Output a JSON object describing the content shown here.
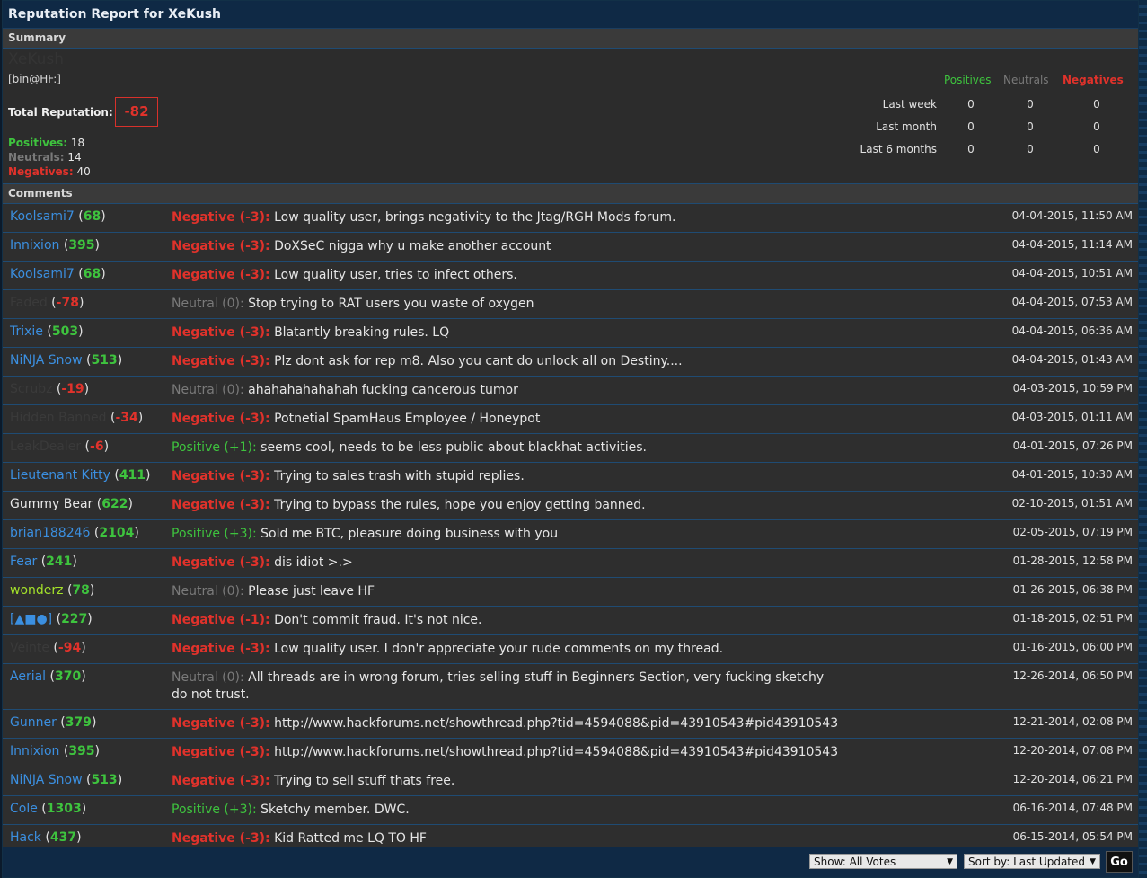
{
  "title": "Reputation Report for XeKush",
  "summary": {
    "heading": "Summary",
    "ghost_name": "XeKush",
    "usertitle": "[bin@HF:]",
    "total_label": "Total Reputation:",
    "total_value": "-82",
    "positives_label": "Positives:",
    "positives_value": "18",
    "neutrals_label": "Neutrals:",
    "neutrals_value": "14",
    "negatives_label": "Negatives:",
    "negatives_value": "40",
    "table_headers": {
      "positives": "Positives",
      "neutrals": "Neutrals",
      "negatives": "Negatives"
    },
    "periods": [
      {
        "label": "Last week",
        "pos": "0",
        "neu": "0",
        "neg": "0"
      },
      {
        "label": "Last month",
        "pos": "0",
        "neu": "0",
        "neg": "0"
      },
      {
        "label": "Last 6 months",
        "pos": "0",
        "neu": "0",
        "neg": "0"
      }
    ]
  },
  "comments_heading": "Comments",
  "comments": [
    {
      "user": "Koolsami7",
      "user_style": "blue",
      "rep": "68",
      "rep_style": "g",
      "type": "neg",
      "tag": "Negative (-3):",
      "text": "Low quality user, brings negativity to the Jtag/RGH Mods forum.",
      "date": "04-04-2015, 11:50 AM"
    },
    {
      "user": "Innixion",
      "user_style": "blue",
      "rep": "395",
      "rep_style": "g",
      "type": "neg",
      "tag": "Negative (-3):",
      "text": "DoXSeC nigga why u make another account",
      "date": "04-04-2015, 11:14 AM"
    },
    {
      "user": "Koolsami7",
      "user_style": "blue",
      "rep": "68",
      "rep_style": "g",
      "type": "neg",
      "tag": "Negative (-3):",
      "text": "Low quality user, tries to infect others.",
      "date": "04-04-2015, 10:51 AM"
    },
    {
      "user": "Faded",
      "user_style": "ghost",
      "rep": "-78",
      "rep_style": "r",
      "type": "neu",
      "tag": "Neutral (0):",
      "text": "Stop trying to RAT users you waste of oxygen",
      "date": "04-04-2015, 07:53 AM"
    },
    {
      "user": "Trixie",
      "user_style": "blue",
      "rep": "503",
      "rep_style": "g",
      "type": "neg",
      "tag": "Negative (-3):",
      "text": "Blatantly breaking rules. LQ",
      "date": "04-04-2015, 06:36 AM"
    },
    {
      "user": "NiNJA Snow",
      "user_style": "blue",
      "rep": "513",
      "rep_style": "g",
      "type": "neg",
      "tag": "Negative (-3):",
      "text": "Plz dont ask for rep m8. Also you cant do unlock all on Destiny....",
      "date": "04-04-2015, 01:43 AM"
    },
    {
      "user": "Scrubz",
      "user_style": "ghost",
      "rep": "-19",
      "rep_style": "r",
      "type": "neu",
      "tag": "Neutral (0):",
      "text": "ahahahahahahah fucking cancerous tumor",
      "date": "04-03-2015, 10:59 PM"
    },
    {
      "user": "Hidden Banned",
      "user_style": "ghost",
      "rep": "-34",
      "rep_style": "r",
      "type": "neg",
      "tag": "Negative (-3):",
      "text": "Potnetial SpamHaus Employee / Honeypot",
      "date": "04-03-2015, 01:11 AM"
    },
    {
      "user": "LeakDealer",
      "user_style": "ghost",
      "rep": "-6",
      "rep_style": "r",
      "type": "pos",
      "tag": "Positive (+1):",
      "text": "seems cool, needs to be less public about blackhat activities.",
      "date": "04-01-2015, 07:26 PM"
    },
    {
      "user": "Lieutenant Kitty",
      "user_style": "blue",
      "rep": "411",
      "rep_style": "g",
      "type": "neg",
      "tag": "Negative (-3):",
      "text": "Trying to sales trash with stupid replies.",
      "date": "04-01-2015, 10:30 AM"
    },
    {
      "user": "Gummy Bear",
      "user_style": "white",
      "rep": "622",
      "rep_style": "g",
      "type": "neg",
      "tag": "Negative (-3):",
      "text": "Trying to bypass the rules, hope you enjoy getting banned.",
      "date": "02-10-2015, 01:51 AM"
    },
    {
      "user": "brian188246",
      "user_style": "blue",
      "rep": "2104",
      "rep_style": "g",
      "type": "pos",
      "tag": "Positive (+3):",
      "text": "Sold me BTC, pleasure doing business with you",
      "date": "02-05-2015, 07:19 PM"
    },
    {
      "user": "Fear",
      "user_style": "blue",
      "rep": "241",
      "rep_style": "g",
      "type": "neg",
      "tag": "Negative (-3):",
      "text": "dis idiot >.>",
      "date": "01-28-2015, 12:58 PM"
    },
    {
      "user": "wonderz",
      "user_style": "lime",
      "rep": "78",
      "rep_style": "g",
      "type": "neu",
      "tag": "Neutral (0):",
      "text": "Please just leave HF",
      "date": "01-26-2015, 06:38 PM"
    },
    {
      "user": "[▲■●]",
      "user_style": "blue",
      "rep": "227",
      "rep_style": "g",
      "type": "neg",
      "tag": "Negative (-1):",
      "text": "Don't commit fraud. It's not nice.",
      "date": "01-18-2015, 02:51 PM"
    },
    {
      "user": "Veinte",
      "user_style": "ghost",
      "rep": "-94",
      "rep_style": "r",
      "type": "neg",
      "tag": "Negative (-3):",
      "text": "Low quality user. I don'r appreciate your rude comments on my thread.",
      "date": "01-16-2015, 06:00 PM"
    },
    {
      "user": "Aerial",
      "user_style": "blue",
      "rep": "370",
      "rep_style": "g",
      "type": "neu",
      "tag": "Neutral (0):",
      "text": "All threads are in wrong forum, tries selling stuff in Beginners Section, very fucking sketchy do not trust.",
      "date": "12-26-2014, 06:50 PM"
    },
    {
      "user": "Gunner",
      "user_style": "blue",
      "rep": "379",
      "rep_style": "g",
      "type": "neg",
      "tag": "Negative (-3):",
      "text": "http://www.hackforums.net/showthread.php?tid=4594088&pid=43910543#pid43910543",
      "date": "12-21-2014, 02:08 PM"
    },
    {
      "user": "Innixion",
      "user_style": "blue",
      "rep": "395",
      "rep_style": "g",
      "type": "neg",
      "tag": "Negative (-3):",
      "text": "http://www.hackforums.net/showthread.php?tid=4594088&pid=43910543#pid43910543",
      "date": "12-20-2014, 07:08 PM"
    },
    {
      "user": "NiNJA Snow",
      "user_style": "blue",
      "rep": "513",
      "rep_style": "g",
      "type": "neg",
      "tag": "Negative (-3):",
      "text": "Trying to sell stuff thats free.",
      "date": "12-20-2014, 06:21 PM"
    },
    {
      "user": "Cole",
      "user_style": "blue",
      "rep": "1303",
      "rep_style": "g",
      "type": "pos",
      "tag": "Positive (+3):",
      "text": "Sketchy member. DWC.",
      "date": "06-16-2014, 07:48 PM"
    },
    {
      "user": "Hack",
      "user_style": "blue",
      "rep": "437",
      "rep_style": "g",
      "type": "neg",
      "tag": "Negative (-3):",
      "text": "Kid Ratted me LQ TO HF",
      "date": "06-15-2014, 05:54 PM"
    }
  ],
  "footer": {
    "show_select": "Show: All Votes",
    "sort_select": "Sort by: Last Updated",
    "go_label": "Go"
  },
  "colors": {
    "positive": "#3ec33e",
    "neutral": "#7a7a7a",
    "negative": "#e0322b",
    "link": "#3b8fe0",
    "header_bg": "#0f2945"
  }
}
